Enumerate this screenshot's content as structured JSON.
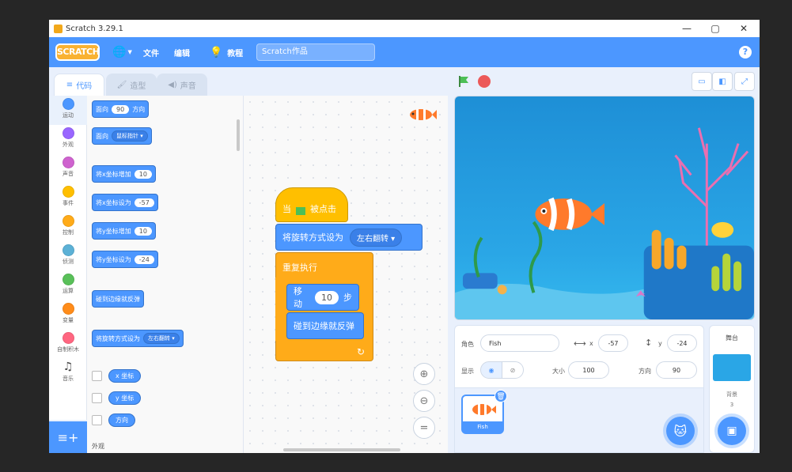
{
  "window": {
    "title": "Scratch 3.29.1"
  },
  "menubar": {
    "logo": "SCRATCH",
    "file": "文件",
    "edit": "编辑",
    "tutorials": "教程",
    "project_title": "Scratch作品"
  },
  "tabs": {
    "code": "代码",
    "costumes": "造型",
    "sounds": "声音"
  },
  "categories": [
    {
      "label": "运动",
      "color": "#4c97ff"
    },
    {
      "label": "外观",
      "color": "#9966ff"
    },
    {
      "label": "声音",
      "color": "#cf63cf"
    },
    {
      "label": "事件",
      "color": "#ffbf00"
    },
    {
      "label": "控制",
      "color": "#ffab19"
    },
    {
      "label": "侦测",
      "color": "#5cb1d6"
    },
    {
      "label": "运算",
      "color": "#59c059"
    },
    {
      "label": "变量",
      "color": "#ff8c1a"
    },
    {
      "label": "自制积木",
      "color": "#ff6680"
    },
    {
      "label": "音乐",
      "color": ""
    }
  ],
  "palette": {
    "point_dir": {
      "label": "面向",
      "value": "90",
      "suffix": "方向"
    },
    "point_towards": {
      "label": "面向",
      "option": "鼠标指针"
    },
    "change_x": {
      "label": "将x坐标增加",
      "value": "10"
    },
    "set_x": {
      "label": "将x坐标设为",
      "value": "-57"
    },
    "change_y": {
      "label": "将y坐标增加",
      "value": "10"
    },
    "set_y": {
      "label": "将y坐标设为",
      "value": "-24"
    },
    "bounce": {
      "label": "碰到边缘就反弹"
    },
    "rotation_style": {
      "label": "将旋转方式设为",
      "option": "左右翻转"
    },
    "reporters": [
      "x 坐标",
      "y 坐标",
      "方向"
    ],
    "footer": "外观"
  },
  "script": {
    "when": "当",
    "clicked": "被点击",
    "rotation_label": "将旋转方式设为",
    "rotation_option": "左右翻转",
    "forever": "重复执行",
    "move_label": "移动",
    "move_value": "10",
    "move_unit": "步",
    "bounce": "碰到边缘就反弹"
  },
  "sprite_info": {
    "sprite_label": "角色",
    "sprite_name": "Fish",
    "x_label": "x",
    "x_value": "-57",
    "y_label": "y",
    "y_value": "-24",
    "show_label": "显示",
    "size_label": "大小",
    "size_value": "100",
    "direction_label": "方向",
    "direction_value": "90"
  },
  "sprites": [
    {
      "name": "Fish"
    }
  ],
  "stage_pane": {
    "title": "舞台",
    "backdrop_label": "背景",
    "backdrop_count": "3"
  }
}
